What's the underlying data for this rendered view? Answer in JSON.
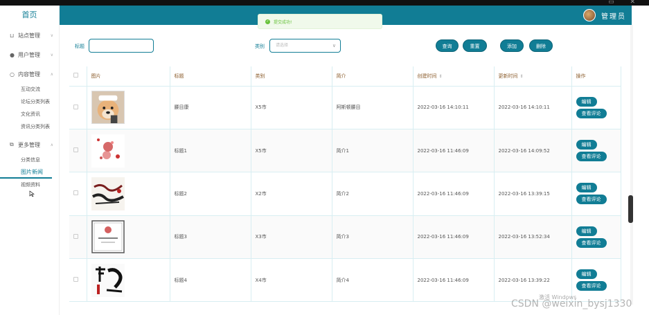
{
  "sidebar": {
    "brand": "首页",
    "groups": [
      {
        "icon": "cart-icon",
        "glyph": "🛒",
        "label": "站点管理"
      },
      {
        "icon": "user-icon",
        "glyph": "👤",
        "label": "用户管理"
      },
      {
        "icon": "chat-icon",
        "glyph": "💬",
        "label": "内容管理",
        "subs": [
          "互动交流",
          "论坛分类列表",
          "文化资讯",
          "资讯分类列表"
        ]
      },
      {
        "icon": "copy-icon",
        "glyph": "⧉",
        "label": "更多管理",
        "subs": [
          "分类信息",
          "图片新闻",
          "视频资料"
        ]
      }
    ],
    "active_sub": "图片新闻"
  },
  "header": {
    "admin_label": "管理员"
  },
  "toast": {
    "message": "提交成功!"
  },
  "filter": {
    "title_label": "标题",
    "title_value": "",
    "category_label": "类别",
    "category_placeholder": "请选择",
    "query_label": "查询",
    "reset_label": "重置",
    "add_label": "添加",
    "delete_label": "删除"
  },
  "table": {
    "headers": [
      "图片",
      "标题",
      "类别",
      "简介",
      "创建时间",
      "更新时间",
      "操作"
    ],
    "rows": [
      {
        "title": "腰目康",
        "category": "X5市",
        "intro": "阿斯顿腰目",
        "created": "2022-03-16 14:10:11",
        "updated": "2022-03-16 14:10:11"
      },
      {
        "title": "标题1",
        "category": "X5市",
        "intro": "简介1",
        "created": "2022-03-16 11:46:09",
        "updated": "2022-03-16 14:09:52"
      },
      {
        "title": "标题2",
        "category": "X2市",
        "intro": "简介2",
        "created": "2022-03-16 11:46:09",
        "updated": "2022-03-16 13:39:15"
      },
      {
        "title": "标题3",
        "category": "X3市",
        "intro": "简介3",
        "created": "2022-03-16 11:46:09",
        "updated": "2022-03-16 13:52:34"
      },
      {
        "title": "标题4",
        "category": "X4市",
        "intro": "简介4",
        "created": "2022-03-16 11:46:09",
        "updated": "2022-03-16 13:39:22"
      }
    ],
    "edit_label": "编辑",
    "review_label": "查看评论"
  },
  "watermark": "激活 Windows",
  "csdn": "CSDN @weixin_bysj1330",
  "colors": {
    "accent": "#117d95",
    "success": "#67c23a"
  }
}
